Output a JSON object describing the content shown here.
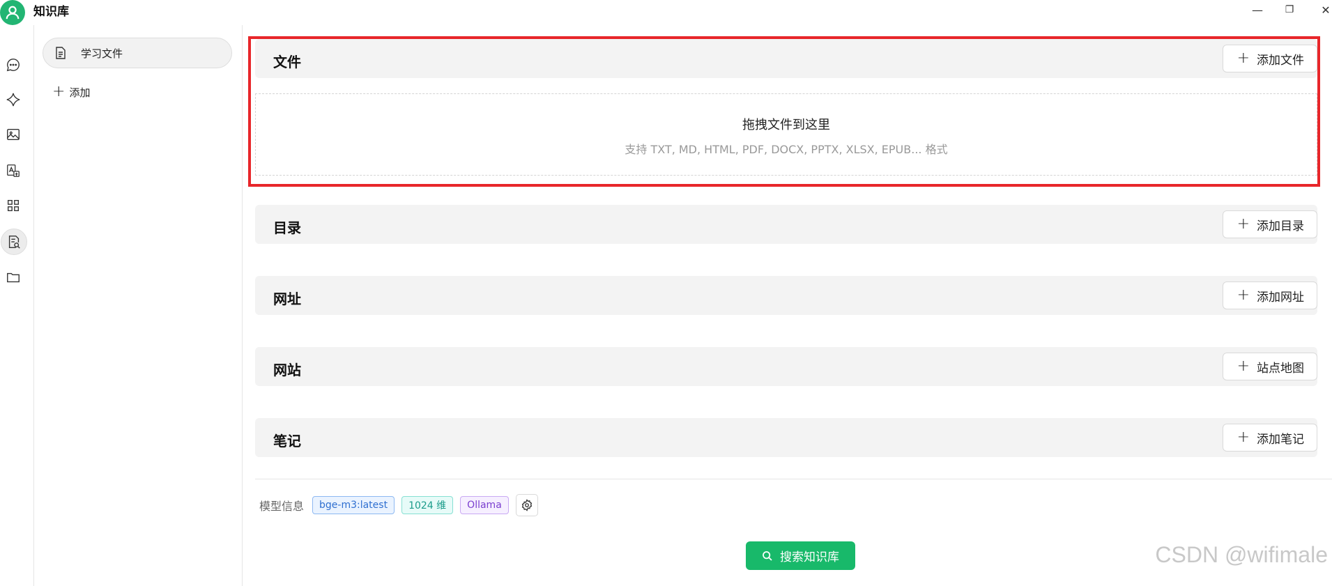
{
  "app": {
    "title": "知识库"
  },
  "window": {
    "minimize_glyph": "—",
    "restore_glyph": "❐",
    "close_glyph": "✕"
  },
  "rail": {
    "items": [
      {
        "icon": "chat-bubble-icon"
      },
      {
        "icon": "sparkle-icon"
      },
      {
        "icon": "image-icon"
      },
      {
        "icon": "translate-icon"
      },
      {
        "icon": "apps-grid-icon"
      },
      {
        "icon": "knowledge-search-icon",
        "active": true
      },
      {
        "icon": "folder-icon"
      }
    ]
  },
  "kb_panel": {
    "items": [
      {
        "label": "学习文件",
        "icon": "document-icon"
      }
    ],
    "add_label": "添加"
  },
  "sections": {
    "files": {
      "title": "文件",
      "button": "添加文件"
    },
    "dropzone": {
      "title": "拖拽文件到这里",
      "hint": "支持 TXT, MD, HTML, PDF, DOCX, PPTX, XLSX, EPUB... 格式"
    },
    "directory": {
      "title": "目录",
      "button": "添加目录"
    },
    "url": {
      "title": "网址",
      "button": "添加网址"
    },
    "website": {
      "title": "网站",
      "button": "站点地图"
    },
    "notes": {
      "title": "笔记",
      "button": "添加笔记"
    }
  },
  "model_info": {
    "label": "模型信息",
    "model": "bge-m3:latest",
    "dimensions": "1024 维",
    "provider": "Ollama"
  },
  "search_button": "搜索知识库",
  "watermark": "CSDN @wifimale",
  "colors": {
    "accent": "#18b96a",
    "highlight_border": "#e8262a",
    "avatar": "#22b573"
  }
}
